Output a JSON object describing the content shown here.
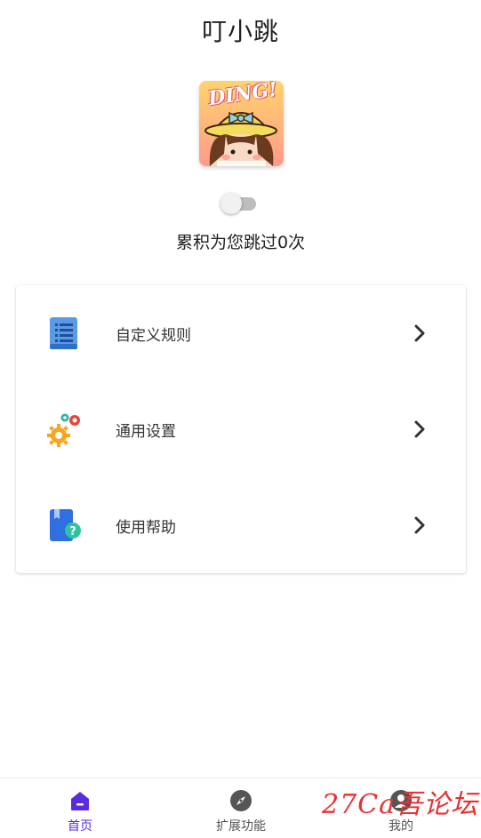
{
  "header": {
    "title": "叮小跳"
  },
  "logo": {
    "text": "DING!"
  },
  "service_toggle": {
    "on": false
  },
  "stats": {
    "skip_count_text": "累积为您跳过0次"
  },
  "menu": {
    "items": [
      {
        "label": "自定义规则",
        "icon": "document-list-icon"
      },
      {
        "label": "通用设置",
        "icon": "gears-icon"
      },
      {
        "label": "使用帮助",
        "icon": "help-book-icon"
      }
    ]
  },
  "bottom_nav": {
    "tabs": [
      {
        "label": "首页",
        "icon": "home-icon",
        "active": true
      },
      {
        "label": "扩展功能",
        "icon": "compass-icon",
        "active": false
      },
      {
        "label": "我的",
        "icon": "user-icon",
        "active": false
      }
    ]
  },
  "watermark": {
    "text": "27Ca吾论坛"
  },
  "colors": {
    "accent": "#5b2be0",
    "toggle_off": "#bdbdbd",
    "watermark": "#e8312f"
  }
}
